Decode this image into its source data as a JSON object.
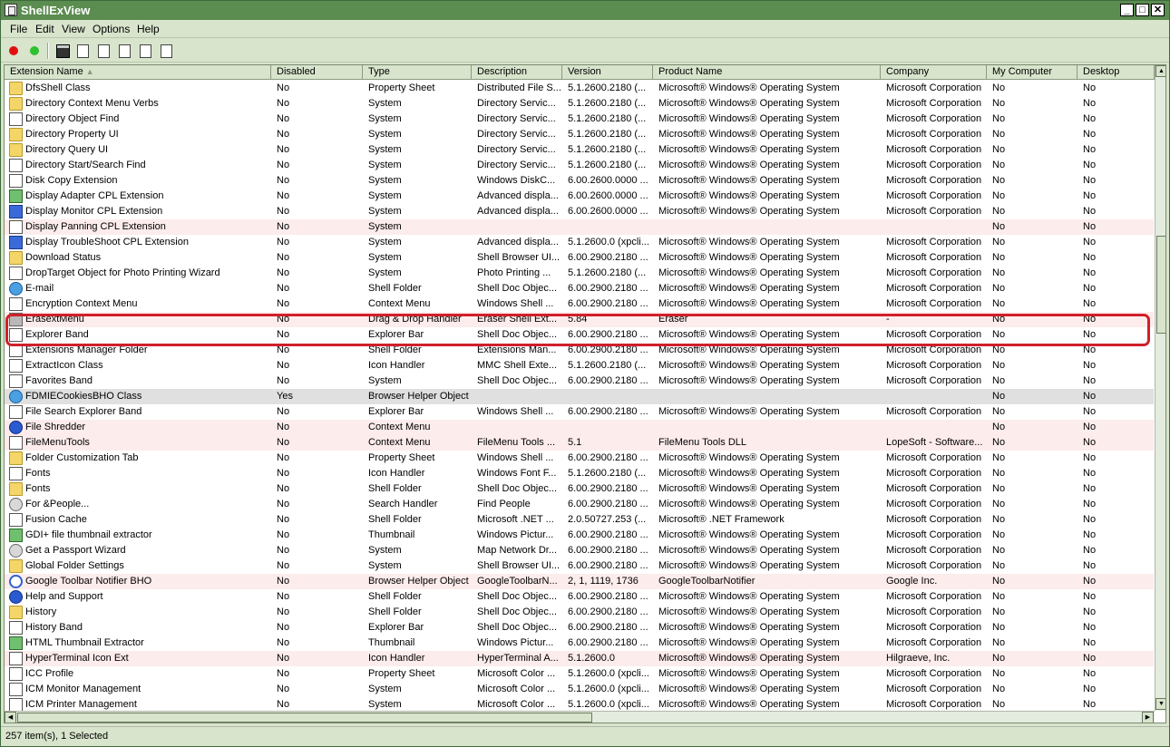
{
  "window": {
    "title": "ShellExView"
  },
  "menu": [
    "File",
    "Edit",
    "View",
    "Options",
    "Help"
  ],
  "toolbar": [
    "disable-icon",
    "enable-icon",
    "save-icon",
    "refresh-icon",
    "copy-icon",
    "properties-icon",
    "find-icon",
    "exit-icon"
  ],
  "columns": [
    "Extension Name",
    "Disabled",
    "Type",
    "Description",
    "Version",
    "Product Name",
    "Company",
    "My Computer",
    "Desktop"
  ],
  "rows": [
    {
      "icon": "folder",
      "cells": [
        "DfsShell Class",
        "No",
        "Property Sheet",
        "Distributed File S...",
        "5.1.2600.2180 (...",
        "Microsoft® Windows® Operating System",
        "Microsoft Corporation",
        "No",
        "No"
      ]
    },
    {
      "icon": "folder",
      "cells": [
        "Directory Context Menu Verbs",
        "No",
        "System",
        "Directory Servic...",
        "5.1.2600.2180 (...",
        "Microsoft® Windows® Operating System",
        "Microsoft Corporation",
        "No",
        "No"
      ]
    },
    {
      "icon": "doc",
      "cells": [
        "Directory Object Find",
        "No",
        "System",
        "Directory Servic...",
        "5.1.2600.2180 (...",
        "Microsoft® Windows® Operating System",
        "Microsoft Corporation",
        "No",
        "No"
      ]
    },
    {
      "icon": "folder",
      "cells": [
        "Directory Property UI",
        "No",
        "System",
        "Directory Servic...",
        "5.1.2600.2180 (...",
        "Microsoft® Windows® Operating System",
        "Microsoft Corporation",
        "No",
        "No"
      ]
    },
    {
      "icon": "folder",
      "cells": [
        "Directory Query UI",
        "No",
        "System",
        "Directory Servic...",
        "5.1.2600.2180 (...",
        "Microsoft® Windows® Operating System",
        "Microsoft Corporation",
        "No",
        "No"
      ]
    },
    {
      "icon": "doc",
      "cells": [
        "Directory Start/Search Find",
        "No",
        "System",
        "Directory Servic...",
        "5.1.2600.2180 (...",
        "Microsoft® Windows® Operating System",
        "Microsoft Corporation",
        "No",
        "No"
      ]
    },
    {
      "icon": "doc",
      "cells": [
        "Disk Copy Extension",
        "No",
        "System",
        "Windows DiskC...",
        "6.00.2600.0000 ...",
        "Microsoft® Windows® Operating System",
        "Microsoft Corporation",
        "No",
        "No"
      ]
    },
    {
      "icon": "green",
      "cells": [
        "Display Adapter CPL Extension",
        "No",
        "System",
        "Advanced displa...",
        "6.00.2600.0000 ...",
        "Microsoft® Windows® Operating System",
        "Microsoft Corporation",
        "No",
        "No"
      ]
    },
    {
      "icon": "blue",
      "cells": [
        "Display Monitor CPL Extension",
        "No",
        "System",
        "Advanced displa...",
        "6.00.2600.0000 ...",
        "Microsoft® Windows® Operating System",
        "Microsoft Corporation",
        "No",
        "No"
      ]
    },
    {
      "icon": "doc",
      "pink": true,
      "cells": [
        "Display Panning CPL Extension",
        "No",
        "System",
        "",
        "",
        "",
        "",
        "No",
        "No"
      ]
    },
    {
      "icon": "blue",
      "cells": [
        "Display TroubleShoot CPL Extension",
        "No",
        "System",
        "Advanced displa...",
        "5.1.2600.0 (xpcli...",
        "Microsoft® Windows® Operating System",
        "Microsoft Corporation",
        "No",
        "No"
      ]
    },
    {
      "icon": "folder",
      "cells": [
        "Download Status",
        "No",
        "System",
        "Shell Browser UI...",
        "6.00.2900.2180 ...",
        "Microsoft® Windows® Operating System",
        "Microsoft Corporation",
        "No",
        "No"
      ]
    },
    {
      "icon": "doc",
      "cells": [
        "DropTarget Object for Photo Printing Wizard",
        "No",
        "System",
        "Photo Printing ...",
        "5.1.2600.2180 (...",
        "Microsoft® Windows® Operating System",
        "Microsoft Corporation",
        "No",
        "No"
      ]
    },
    {
      "icon": "globe",
      "cells": [
        "E-mail",
        "No",
        "Shell Folder",
        "Shell Doc Objec...",
        "6.00.2900.2180 ...",
        "Microsoft® Windows® Operating System",
        "Microsoft Corporation",
        "No",
        "No"
      ]
    },
    {
      "icon": "doc",
      "cells": [
        "Encryption Context Menu",
        "No",
        "Context Menu",
        "Windows Shell ...",
        "6.00.2900.2180 ...",
        "Microsoft® Windows® Operating System",
        "Microsoft Corporation",
        "No",
        "No"
      ]
    },
    {
      "icon": "gray",
      "pink": true,
      "cells": [
        "ErasextMenu",
        "No",
        "Drag & Drop Handler",
        "Eraser Shell Ext...",
        "5.84",
        "Eraser",
        "-",
        "No",
        "No"
      ]
    },
    {
      "icon": "doc",
      "cells": [
        "Explorer Band",
        "No",
        "Explorer Bar",
        "Shell Doc Objec...",
        "6.00.2900.2180 ...",
        "Microsoft® Windows® Operating System",
        "Microsoft Corporation",
        "No",
        "No"
      ]
    },
    {
      "icon": "doc",
      "cells": [
        "Extensions Manager Folder",
        "No",
        "Shell Folder",
        "Extensions Man...",
        "6.00.2900.2180 ...",
        "Microsoft® Windows® Operating System",
        "Microsoft Corporation",
        "No",
        "No"
      ]
    },
    {
      "icon": "doc",
      "cells": [
        "ExtractIcon Class",
        "No",
        "Icon Handler",
        "MMC Shell Exte...",
        "5.1.2600.2180 (...",
        "Microsoft® Windows® Operating System",
        "Microsoft Corporation",
        "No",
        "No"
      ]
    },
    {
      "icon": "doc",
      "cells": [
        "Favorites Band",
        "No",
        "System",
        "Shell Doc Objec...",
        "6.00.2900.2180 ...",
        "Microsoft® Windows® Operating System",
        "Microsoft Corporation",
        "No",
        "No"
      ]
    },
    {
      "icon": "globe",
      "selected": true,
      "cells": [
        "FDMIECookiesBHO Class",
        "Yes",
        "Browser Helper Object",
        "",
        "",
        "",
        "",
        "No",
        "No"
      ]
    },
    {
      "icon": "doc",
      "cells": [
        "File Search Explorer Band",
        "No",
        "Explorer Bar",
        "Windows Shell ...",
        "6.00.2900.2180 ...",
        "Microsoft® Windows® Operating System",
        "Microsoft Corporation",
        "No",
        "No"
      ]
    },
    {
      "icon": "help",
      "pink": true,
      "cells": [
        "File Shredder",
        "No",
        "Context Menu",
        "",
        "",
        "",
        "",
        "No",
        "No"
      ]
    },
    {
      "icon": "doc",
      "pink": true,
      "cells": [
        "FileMenuTools",
        "No",
        "Context Menu",
        "FileMenu Tools ...",
        "5.1",
        "FileMenu Tools DLL",
        "LopeSoft - Software...",
        "No",
        "No"
      ]
    },
    {
      "icon": "folder",
      "cells": [
        "Folder Customization Tab",
        "No",
        "Property Sheet",
        "Windows Shell ...",
        "6.00.2900.2180 ...",
        "Microsoft® Windows® Operating System",
        "Microsoft Corporation",
        "No",
        "No"
      ]
    },
    {
      "icon": "doc",
      "cells": [
        "Fonts",
        "No",
        "Icon Handler",
        "Windows Font F...",
        "5.1.2600.2180 (...",
        "Microsoft® Windows® Operating System",
        "Microsoft Corporation",
        "No",
        "No"
      ]
    },
    {
      "icon": "folder",
      "cells": [
        "Fonts",
        "No",
        "Shell Folder",
        "Shell Doc Objec...",
        "6.00.2900.2180 ...",
        "Microsoft® Windows® Operating System",
        "Microsoft Corporation",
        "No",
        "No"
      ]
    },
    {
      "icon": "people",
      "cells": [
        "For &People...",
        "No",
        "Search Handler",
        "Find People",
        "6.00.2900.2180 ...",
        "Microsoft® Windows® Operating System",
        "Microsoft Corporation",
        "No",
        "No"
      ]
    },
    {
      "icon": "doc",
      "cells": [
        "Fusion Cache",
        "No",
        "Shell Folder",
        "Microsoft .NET ...",
        "2.0.50727.253 (...",
        "Microsoft® .NET Framework",
        "Microsoft Corporation",
        "No",
        "No"
      ]
    },
    {
      "icon": "green",
      "cells": [
        "GDI+ file thumbnail extractor",
        "No",
        "Thumbnail",
        "Windows Pictur...",
        "6.00.2900.2180 ...",
        "Microsoft® Windows® Operating System",
        "Microsoft Corporation",
        "No",
        "No"
      ]
    },
    {
      "icon": "people",
      "cells": [
        "Get a Passport Wizard",
        "No",
        "System",
        "Map Network Dr...",
        "6.00.2900.2180 ...",
        "Microsoft® Windows® Operating System",
        "Microsoft Corporation",
        "No",
        "No"
      ]
    },
    {
      "icon": "folder",
      "cells": [
        "Global Folder Settings",
        "No",
        "System",
        "Shell Browser UI...",
        "6.00.2900.2180 ...",
        "Microsoft® Windows® Operating System",
        "Microsoft Corporation",
        "No",
        "No"
      ]
    },
    {
      "icon": "google",
      "pink": true,
      "cells": [
        "Google Toolbar Notifier BHO",
        "No",
        "Browser Helper Object",
        "GoogleToolbarN...",
        "2, 1, 1119, 1736",
        "GoogleToolbarNotifier",
        "Google Inc.",
        "No",
        "No"
      ]
    },
    {
      "icon": "help",
      "cells": [
        "Help and Support",
        "No",
        "Shell Folder",
        "Shell Doc Objec...",
        "6.00.2900.2180 ...",
        "Microsoft® Windows® Operating System",
        "Microsoft Corporation",
        "No",
        "No"
      ]
    },
    {
      "icon": "folder",
      "cells": [
        "History",
        "No",
        "Shell Folder",
        "Shell Doc Objec...",
        "6.00.2900.2180 ...",
        "Microsoft® Windows® Operating System",
        "Microsoft Corporation",
        "No",
        "No"
      ]
    },
    {
      "icon": "doc",
      "cells": [
        "History Band",
        "No",
        "Explorer Bar",
        "Shell Doc Objec...",
        "6.00.2900.2180 ...",
        "Microsoft® Windows® Operating System",
        "Microsoft Corporation",
        "No",
        "No"
      ]
    },
    {
      "icon": "green",
      "cells": [
        "HTML Thumbnail Extractor",
        "No",
        "Thumbnail",
        "Windows Pictur...",
        "6.00.2900.2180 ...",
        "Microsoft® Windows® Operating System",
        "Microsoft Corporation",
        "No",
        "No"
      ]
    },
    {
      "icon": "doc",
      "pink": true,
      "cells": [
        "HyperTerminal Icon Ext",
        "No",
        "Icon Handler",
        "HyperTerminal A...",
        "5.1.2600.0",
        "Microsoft® Windows® Operating System",
        "Hilgraeve, Inc.",
        "No",
        "No"
      ]
    },
    {
      "icon": "doc",
      "cells": [
        "ICC Profile",
        "No",
        "Property Sheet",
        "Microsoft Color ...",
        "5.1.2600.0 (xpcli...",
        "Microsoft® Windows® Operating System",
        "Microsoft Corporation",
        "No",
        "No"
      ]
    },
    {
      "icon": "doc",
      "cells": [
        "ICM Monitor Management",
        "No",
        "System",
        "Microsoft Color ...",
        "5.1.2600.0 (xpcli...",
        "Microsoft® Windows® Operating System",
        "Microsoft Corporation",
        "No",
        "No"
      ]
    },
    {
      "icon": "doc",
      "cells": [
        "ICM Printer Management",
        "No",
        "System",
        "Microsoft Color ...",
        "5.1.2600.0 (xpcli...",
        "Microsoft® Windows® Operating System",
        "Microsoft Corporation",
        "No",
        "No"
      ]
    }
  ],
  "status": "257 item(s), 1 Selected"
}
